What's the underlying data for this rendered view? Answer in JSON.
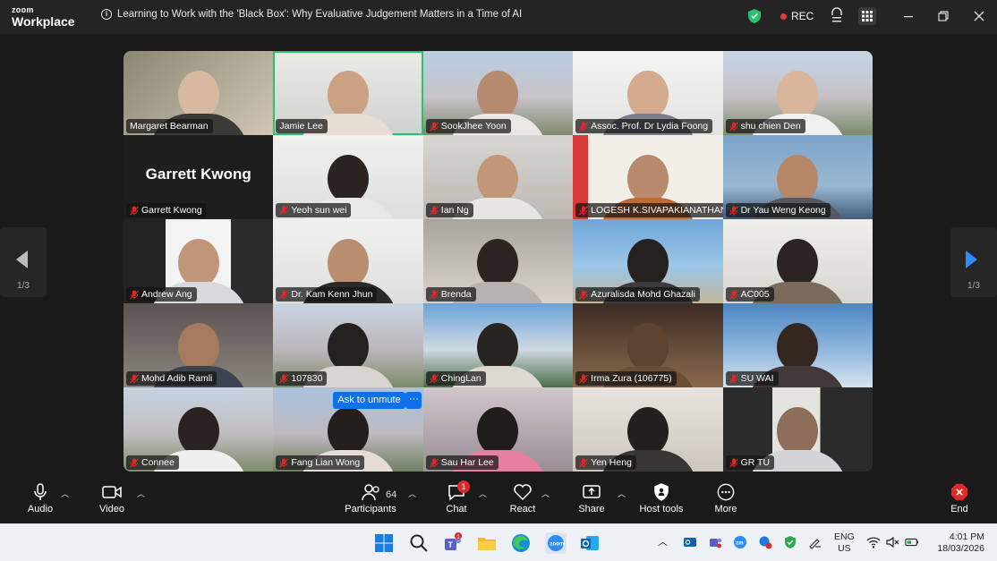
{
  "window": {
    "logo_top": "zoom",
    "logo_bottom": "Workplace",
    "meeting_title": "Learning to Work with the 'Black Box': Why Evaluative Judgement Matters in a Time of AI",
    "rec_label": "REC"
  },
  "pager": {
    "left": "1/3",
    "right": "1/3"
  },
  "grid": {
    "big_name_tile": "Garrett Kwong",
    "ask_to_unmute": "Ask to unmute",
    "more_dots": "···",
    "tiles": [
      {
        "name": "Margaret Bearman",
        "muted": false
      },
      {
        "name": "Jamie Lee",
        "muted": false
      },
      {
        "name": "SookJhee Yoon",
        "muted": true
      },
      {
        "name": "Assoc. Prof. Dr Lydia Foong",
        "muted": true
      },
      {
        "name": "shu chien Den",
        "muted": true
      },
      {
        "name": "Garrett Kwong",
        "muted": true
      },
      {
        "name": "Yeoh sun wei",
        "muted": true
      },
      {
        "name": "Ian Ng",
        "muted": true
      },
      {
        "name": "LOGESH K.SIVAPAKIANATHAN",
        "muted": true
      },
      {
        "name": "Dr Yau Weng Keong",
        "muted": true
      },
      {
        "name": "Andrew Ang",
        "muted": true
      },
      {
        "name": "Dr. Kam Kenn Jhun",
        "muted": true
      },
      {
        "name": "Brenda",
        "muted": true
      },
      {
        "name": "Azuralisda Mohd Ghazali",
        "muted": true
      },
      {
        "name": "AC005",
        "muted": true
      },
      {
        "name": "Mohd Adib Ramli",
        "muted": true
      },
      {
        "name": "107830",
        "muted": true
      },
      {
        "name": "ChingLan",
        "muted": true
      },
      {
        "name": "Irma Zura (106775)",
        "muted": true
      },
      {
        "name": "SU WAI",
        "muted": true
      },
      {
        "name": "Connee",
        "muted": true
      },
      {
        "name": "Fang Lian Wong",
        "muted": true
      },
      {
        "name": "Sau Har Lee",
        "muted": true
      },
      {
        "name": "Yen Heng",
        "muted": true
      },
      {
        "name": "GR TU",
        "muted": true
      }
    ]
  },
  "toolbar": {
    "audio": "Audio",
    "video": "Video",
    "participants": "Participants",
    "participants_count": "64",
    "chat": "Chat",
    "chat_badge": "1",
    "react": "React",
    "share": "Share",
    "host_tools": "Host tools",
    "more": "More",
    "end": "End"
  },
  "taskbar": {
    "teams_badge": "1",
    "lang_top": "ENG",
    "lang_bottom": "US",
    "time": "4:01 PM",
    "date": "18/03/2026"
  },
  "colors": {
    "accent": "#0e71eb",
    "active_speaker": "#27c26b",
    "end": "#e02828"
  }
}
